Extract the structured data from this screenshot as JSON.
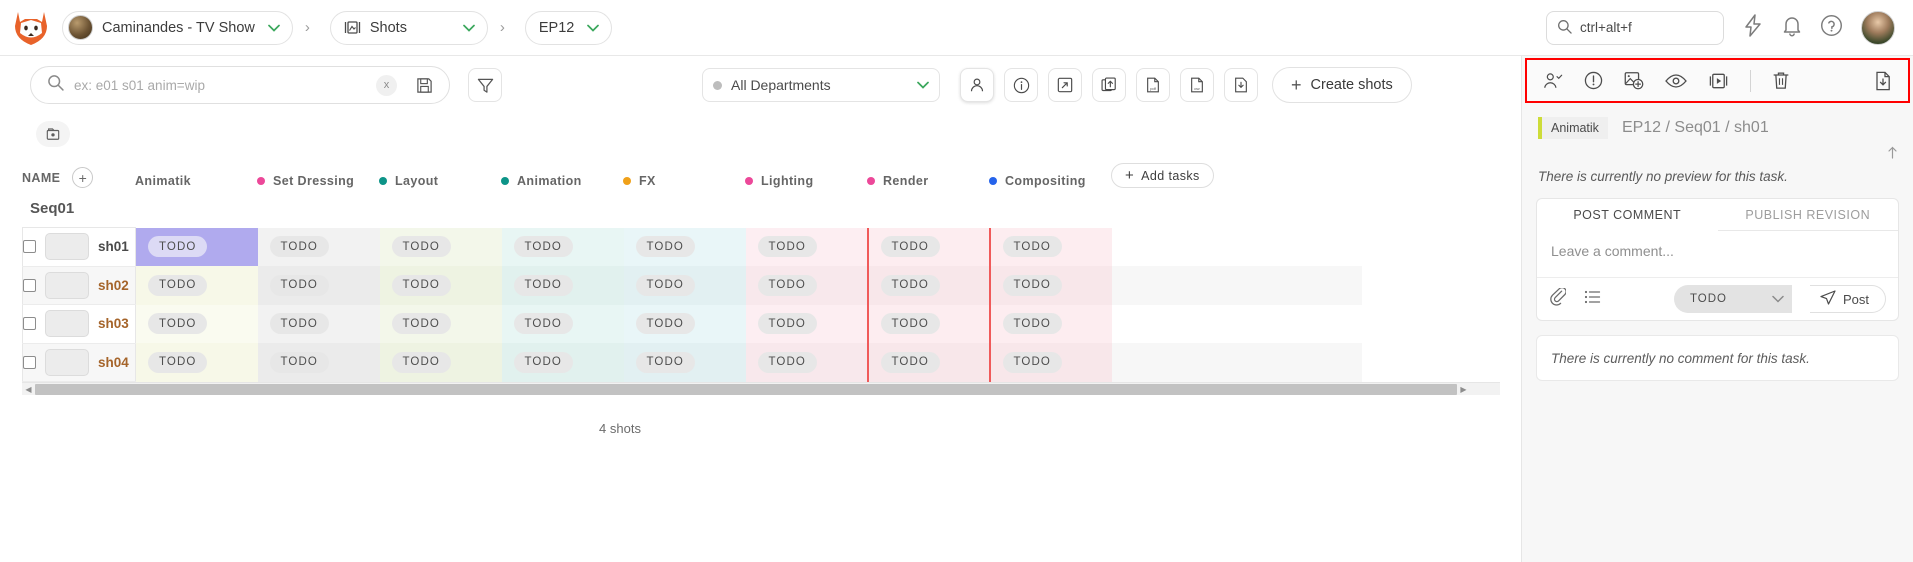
{
  "topbar": {
    "logo_icon": "fox-logo-icon",
    "project": {
      "label": "Caminandes - TV Show",
      "avatar": "project-avatar"
    },
    "section": {
      "label": "Shots",
      "icon": "shots-icon"
    },
    "episode": {
      "label": "EP12"
    },
    "separator": "›",
    "chevron": "⌄",
    "search": {
      "value": "ctrl+alt+f",
      "placeholder": "ctrl+alt+f",
      "icon": "search-icon"
    },
    "actions": [
      "bolt-icon",
      "bell-icon",
      "help-icon",
      "user-avatar"
    ]
  },
  "toolbar": {
    "search_placeholder": "ex: e01 s01 anim=wip",
    "clear_label": "x",
    "save_search_icon": "save-icon",
    "filter_icon": "filter-icon",
    "department": {
      "label": "All Departments"
    },
    "buttons": [
      {
        "name": "assignee-button",
        "icon": "person-icon"
      },
      {
        "name": "info-button",
        "icon": "info-icon"
      },
      {
        "name": "expand-button",
        "icon": "expand-icon"
      },
      {
        "name": "import-button",
        "icon": "upload-icon"
      },
      {
        "name": "export-pdf-button",
        "icon": "file-pdf-icon"
      },
      {
        "name": "export-csv-button",
        "icon": "file-csv-icon"
      },
      {
        "name": "download-button",
        "icon": "file-download-icon"
      }
    ],
    "create_label": "Create shots",
    "create_plus": "+",
    "playlist_icon": "playlist-icon"
  },
  "table": {
    "name_header": "NAME",
    "add_column_label": "+",
    "add_tasks_label": "Add tasks",
    "add_tasks_plus": "+",
    "columns": [
      {
        "label": "Animatik",
        "color": "",
        "bg": "#fafbf0"
      },
      {
        "label": "Set Dressing",
        "color": "#ec4899",
        "bg": "#f5f5f5"
      },
      {
        "label": "Layout",
        "color": "#0d9488",
        "bg": "#f4f8ec"
      },
      {
        "label": "Animation",
        "color": "#0d9488",
        "bg": "#e9f7f5"
      },
      {
        "label": "FX",
        "color": "#f0a11a",
        "bg": "#eaf7f8"
      },
      {
        "label": "Lighting",
        "color": "#ec4899",
        "bg": "#fdeff2"
      },
      {
        "label": "Render",
        "color": "#ec4899",
        "bg": "#fdeef0"
      },
      {
        "label": "Compositing",
        "color": "#2563eb",
        "bg": "#fdeef0"
      }
    ],
    "sequence": "Seq01",
    "rows": [
      {
        "name": "sh01",
        "accent": false,
        "cells": [
          "TODO",
          "TODO",
          "TODO",
          "TODO",
          "TODO",
          "TODO",
          "TODO",
          "TODO"
        ],
        "selected_col": 0
      },
      {
        "name": "sh02",
        "accent": true,
        "cells": [
          "TODO",
          "TODO",
          "TODO",
          "TODO",
          "TODO",
          "TODO",
          "TODO",
          "TODO"
        ],
        "selected_col": -1
      },
      {
        "name": "sh03",
        "accent": true,
        "cells": [
          "TODO",
          "TODO",
          "TODO",
          "TODO",
          "TODO",
          "TODO",
          "TODO",
          "TODO"
        ],
        "selected_col": -1
      },
      {
        "name": "sh04",
        "accent": true,
        "cells": [
          "TODO",
          "TODO",
          "TODO",
          "TODO",
          "TODO",
          "TODO",
          "TODO",
          "TODO"
        ],
        "selected_col": -1
      }
    ],
    "count_label": "4 shots"
  },
  "panel": {
    "toolbar_icons": [
      {
        "name": "assign-person-icon"
      },
      {
        "name": "alert-circle-icon"
      },
      {
        "name": "add-preview-icon"
      },
      {
        "name": "eye-icon"
      },
      {
        "name": "playlist-video-icon"
      },
      {
        "name": "trash-icon"
      },
      {
        "name": "download-file-icon"
      }
    ],
    "task_type": "Animatik",
    "entity_path": "EP12 / Seq01 / sh01",
    "collapse_icon": "collapse-icon",
    "no_preview_text": "There is currently no preview for this task.",
    "tabs": [
      {
        "label": "POST COMMENT",
        "active": true
      },
      {
        "label": "PUBLISH REVISION",
        "active": false
      }
    ],
    "comment_placeholder": "Leave a comment...",
    "attach_icon": "paperclip-icon",
    "checklist_icon": "checklist-icon",
    "status_value": "TODO",
    "post_label": "Post",
    "post_icon": "send-icon",
    "no_comment_text": "There is currently no comment for this task."
  },
  "colors": {
    "highlight_box": "#ff0000",
    "selected_cell": "#b0aaee",
    "accent_green": "#3aa75c"
  }
}
